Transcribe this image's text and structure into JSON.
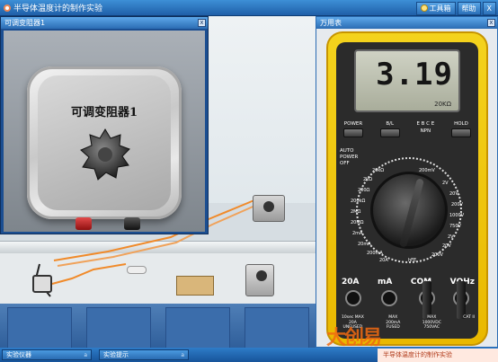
{
  "app": {
    "title": "半导体温度计的制作实验",
    "toolbox_label": "工具箱",
    "help_label": "帮助",
    "exit_label": "X"
  },
  "rheostat_window": {
    "title": "可调变阻器1",
    "device_label": "可调变阻器1",
    "close_label": "x"
  },
  "multimeter_window": {
    "title": "万用表",
    "close_label": "x",
    "reading": "3.19",
    "unit": "20KΩ",
    "buttons": [
      "POWER",
      "B/L",
      "E B C E",
      "HOLD"
    ],
    "button_sub": [
      "",
      "",
      "NPN",
      "PNP"
    ],
    "power_text": [
      "AUTO",
      "POWER",
      "OFF"
    ],
    "ranges_left": [
      "200Ω",
      "2kΩ",
      "20kΩ",
      "200kΩ",
      "2MΩ",
      "20MΩ",
      "2mA",
      "20mA",
      "200mA",
      "20A"
    ],
    "ranges_right": [
      "200mV",
      "2V",
      "20V",
      "200V",
      "1000V",
      "750V",
      "2V",
      "20V",
      "200V",
      "hFE"
    ],
    "socket_labels": [
      "20A",
      "mA",
      "COM",
      "VΩHz"
    ],
    "socket_notes": [
      "10sec MAX\n20A\nUNFUSED",
      "MAX\n200mA\nFUSED",
      "MAX\n1000VDC\n750VAC",
      "CAT II"
    ]
  },
  "statusbar": {
    "tab1": "实验仪器",
    "tab2": "实验提示",
    "pin": "a",
    "running": "半导体温度计的制作实验"
  },
  "watermark": "大创易"
}
